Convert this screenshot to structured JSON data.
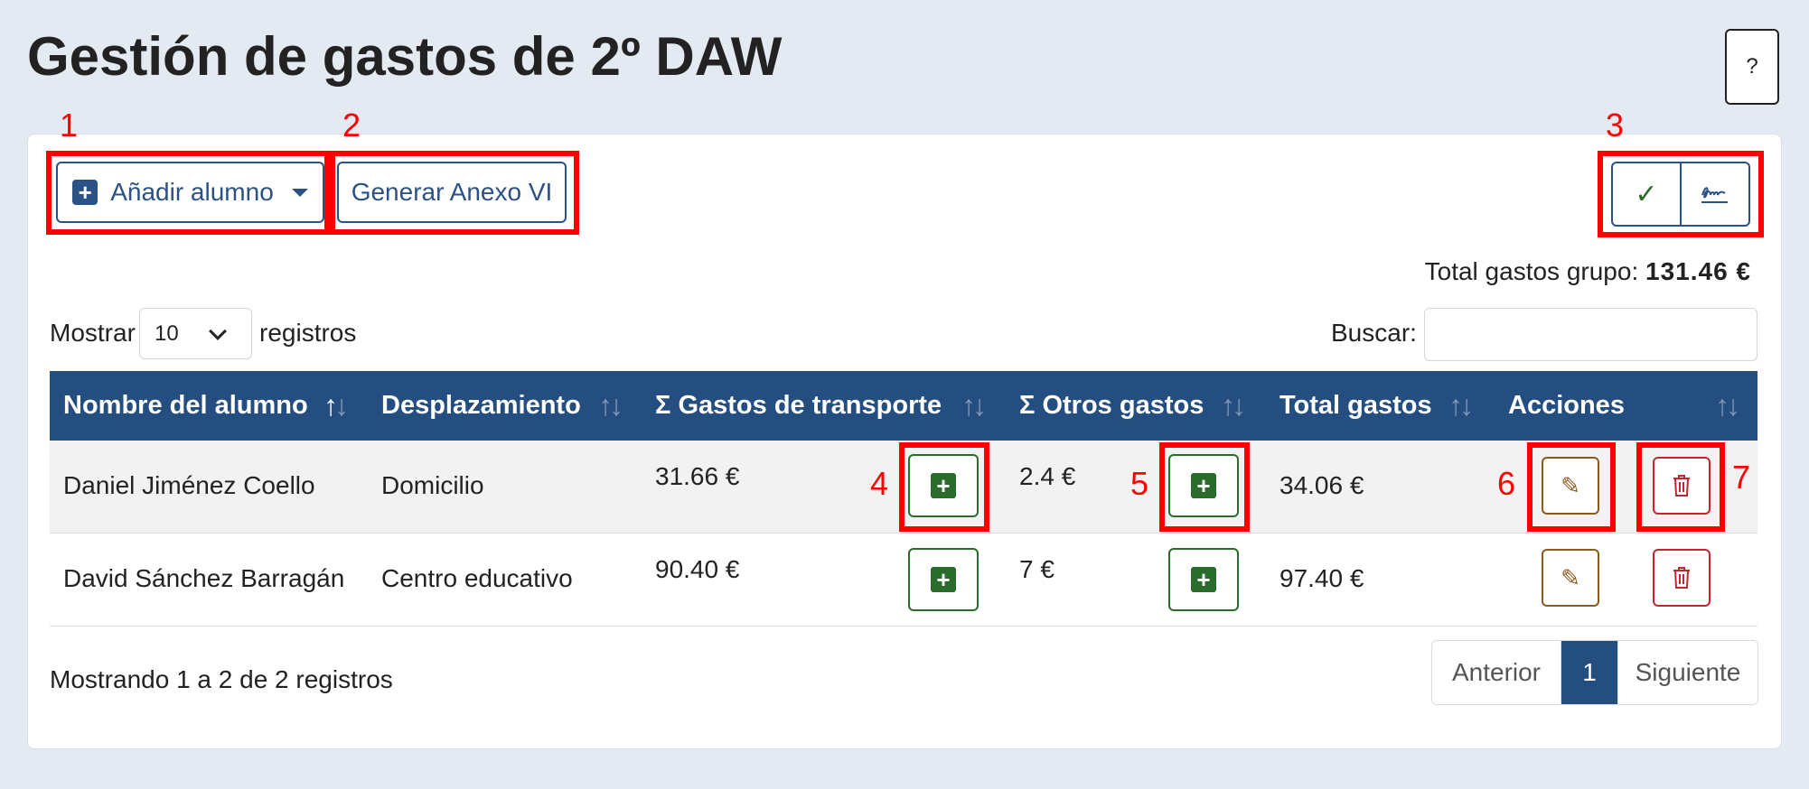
{
  "page": {
    "title": "Gestión de gastos de 2º DAW",
    "help_label": "?"
  },
  "toolbar": {
    "add_student_label": "Añadir alumno",
    "generate_annex_label": "Generar Anexo VI",
    "check_icon": "check-icon",
    "sign_icon": "signature-icon"
  },
  "summary": {
    "total_label": "Total gastos grupo:",
    "total_value": "131.46 €"
  },
  "controls": {
    "show_label": "Mostrar",
    "page_size": "10",
    "records_label": "registros",
    "search_label": "Buscar:",
    "search_value": ""
  },
  "table": {
    "headers": [
      "Nombre del alumno",
      "Desplazamiento",
      "Σ Gastos de transporte",
      "Σ Otros gastos",
      "Total gastos",
      "Acciones"
    ],
    "rows": [
      {
        "name": "Daniel Jiménez Coello",
        "travel": "Domicilio",
        "transport": "31.66 €",
        "other": "2.4 €",
        "total": "34.06 €"
      },
      {
        "name": "David Sánchez Barragán",
        "travel": "Centro educativo",
        "transport": "90.40 €",
        "other": "7 €",
        "total": "97.40 €"
      }
    ]
  },
  "footer": {
    "info": "Mostrando 1 a 2 de 2 registros",
    "prev": "Anterior",
    "current": "1",
    "next": "Siguiente"
  },
  "annotations": [
    "1",
    "2",
    "3",
    "4",
    "5",
    "6",
    "7"
  ],
  "colors": {
    "accent": "#254e80",
    "annotation": "#ff0000",
    "success": "#2b6b2b",
    "warning": "#8a5a1c",
    "danger": "#c0262c"
  }
}
